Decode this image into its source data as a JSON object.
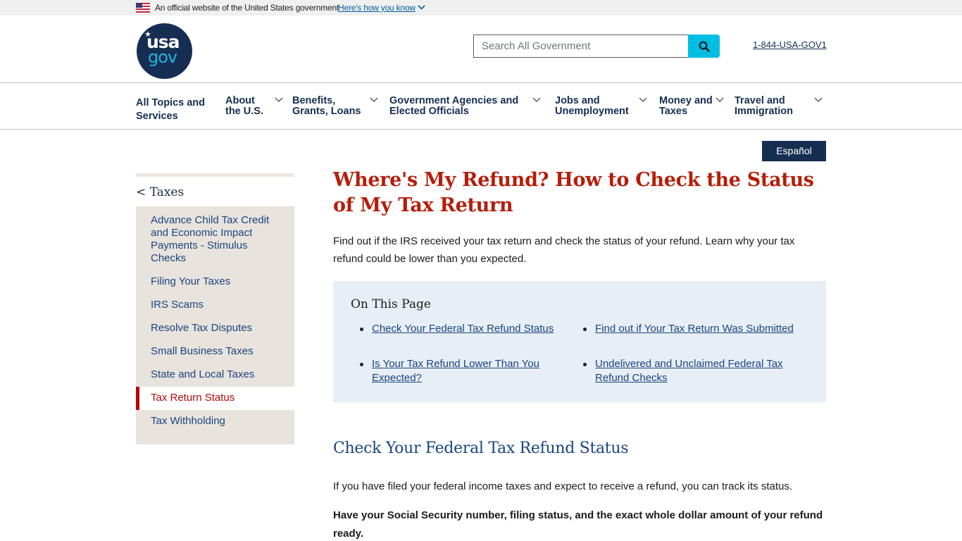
{
  "banner": {
    "official_text": "An official website of the United States government",
    "how_you_know": "Here's how you know"
  },
  "header": {
    "logo_top": "usa",
    "logo_bottom": "gov",
    "search_placeholder": "Search All Government",
    "phone": "1-844-USA-GOV1"
  },
  "nav": {
    "items": [
      {
        "label_l1": "All Topics and",
        "label_l2": "Services",
        "has_dropdown": false
      },
      {
        "label_l1": "About",
        "label_l2": "the U.S.",
        "has_dropdown": true
      },
      {
        "label_l1": "Benefits,",
        "label_l2": "Grants, Loans",
        "has_dropdown": true
      },
      {
        "label_l1": "Government Agencies and",
        "label_l2": "Elected Officials",
        "has_dropdown": true
      },
      {
        "label_l1": "Jobs and",
        "label_l2": "Unemployment",
        "has_dropdown": true
      },
      {
        "label_l1": "Money and",
        "label_l2": "Taxes",
        "has_dropdown": true
      },
      {
        "label_l1": "Travel and",
        "label_l2": "Immigration",
        "has_dropdown": true
      }
    ]
  },
  "language_button": "Español",
  "sidebar": {
    "back_label": "< Taxes",
    "items": [
      {
        "label": "Advance Child Tax Credit and Economic Impact Payments - Stimulus Checks",
        "active": false
      },
      {
        "label": "Filing Your Taxes",
        "active": false
      },
      {
        "label": "IRS Scams",
        "active": false
      },
      {
        "label": "Resolve Tax Disputes",
        "active": false
      },
      {
        "label": "Small Business Taxes",
        "active": false
      },
      {
        "label": "State and Local Taxes",
        "active": false
      },
      {
        "label": "Tax Return Status",
        "active": true
      },
      {
        "label": "Tax Withholding",
        "active": false
      }
    ]
  },
  "main": {
    "title": "Where's My Refund? How to Check the Status of My Tax Return",
    "intro": "Find out if the IRS received your tax return and check the status of your refund. Learn why your tax refund could be lower than you expected.",
    "on_this_page": {
      "heading": "On This Page",
      "links": [
        "Check Your Federal Tax Refund Status",
        "Find out if Your Tax Return Was Submitted",
        "Is Your Tax Refund Lower Than You Expected?",
        "Undelivered and Unclaimed Federal Tax Refund Checks"
      ]
    },
    "section_title": "Check Your Federal Tax Refund Status",
    "paragraph": "If you have filed your federal income taxes and expect to receive a refund, you can track its status.",
    "bold_paragraph": "Have your Social Security number, filing status, and the exact whole dollar amount of your refund ready."
  },
  "colors": {
    "navy": "#162e51",
    "link_blue": "#1a4480",
    "title_red": "#b51d09",
    "search_cyan": "#00bde3",
    "sidebar_bg": "#e8e3dc",
    "otp_bg": "#e7eef5"
  }
}
